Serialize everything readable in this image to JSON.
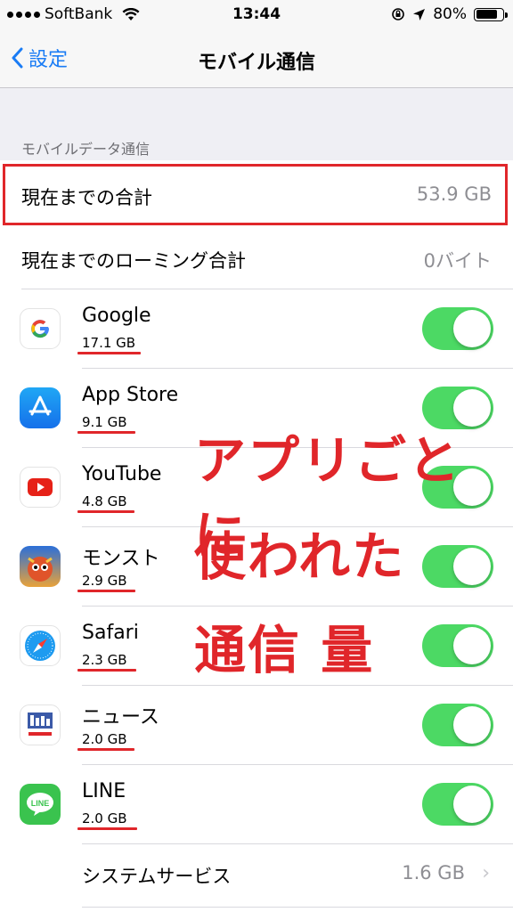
{
  "status_bar": {
    "carrier": "SoftBank",
    "time": "13:44",
    "battery_pct": "80%"
  },
  "nav": {
    "back_label": "設定",
    "title": "モバイル通信"
  },
  "section_header": "モバイルデータ通信",
  "totals": [
    {
      "label": "現在までの合計",
      "value": "53.9 GB"
    },
    {
      "label": "現在までのローミング合計",
      "value": "0バイト"
    }
  ],
  "apps": [
    {
      "name": "Google",
      "usage": "17.1 GB",
      "icon": "google-icon",
      "enabled": true
    },
    {
      "name": "App Store",
      "usage": "9.1 GB",
      "icon": "app-store-icon",
      "enabled": true
    },
    {
      "name": "YouTube",
      "usage": "4.8 GB",
      "icon": "youtube-icon",
      "enabled": true
    },
    {
      "name": "モンスト",
      "usage": "2.9 GB",
      "icon": "monst-icon",
      "enabled": true
    },
    {
      "name": "Safari",
      "usage": "2.3 GB",
      "icon": "safari-icon",
      "enabled": true
    },
    {
      "name": "ニュース",
      "usage": "2.0 GB",
      "icon": "yahoo-news-icon",
      "enabled": true
    },
    {
      "name": "LINE",
      "usage": "2.0 GB",
      "icon": "line-icon",
      "enabled": true
    }
  ],
  "system_services": {
    "label": "システムサービス",
    "value": "1.6 GB"
  },
  "annotation": {
    "line1": "アプリごとに",
    "line2": "使われた",
    "line3": "通信 量"
  },
  "colors": {
    "accent_blue": "#1a7cf5",
    "toggle_green": "#4cd964",
    "annotation_red": "#e0262a"
  }
}
